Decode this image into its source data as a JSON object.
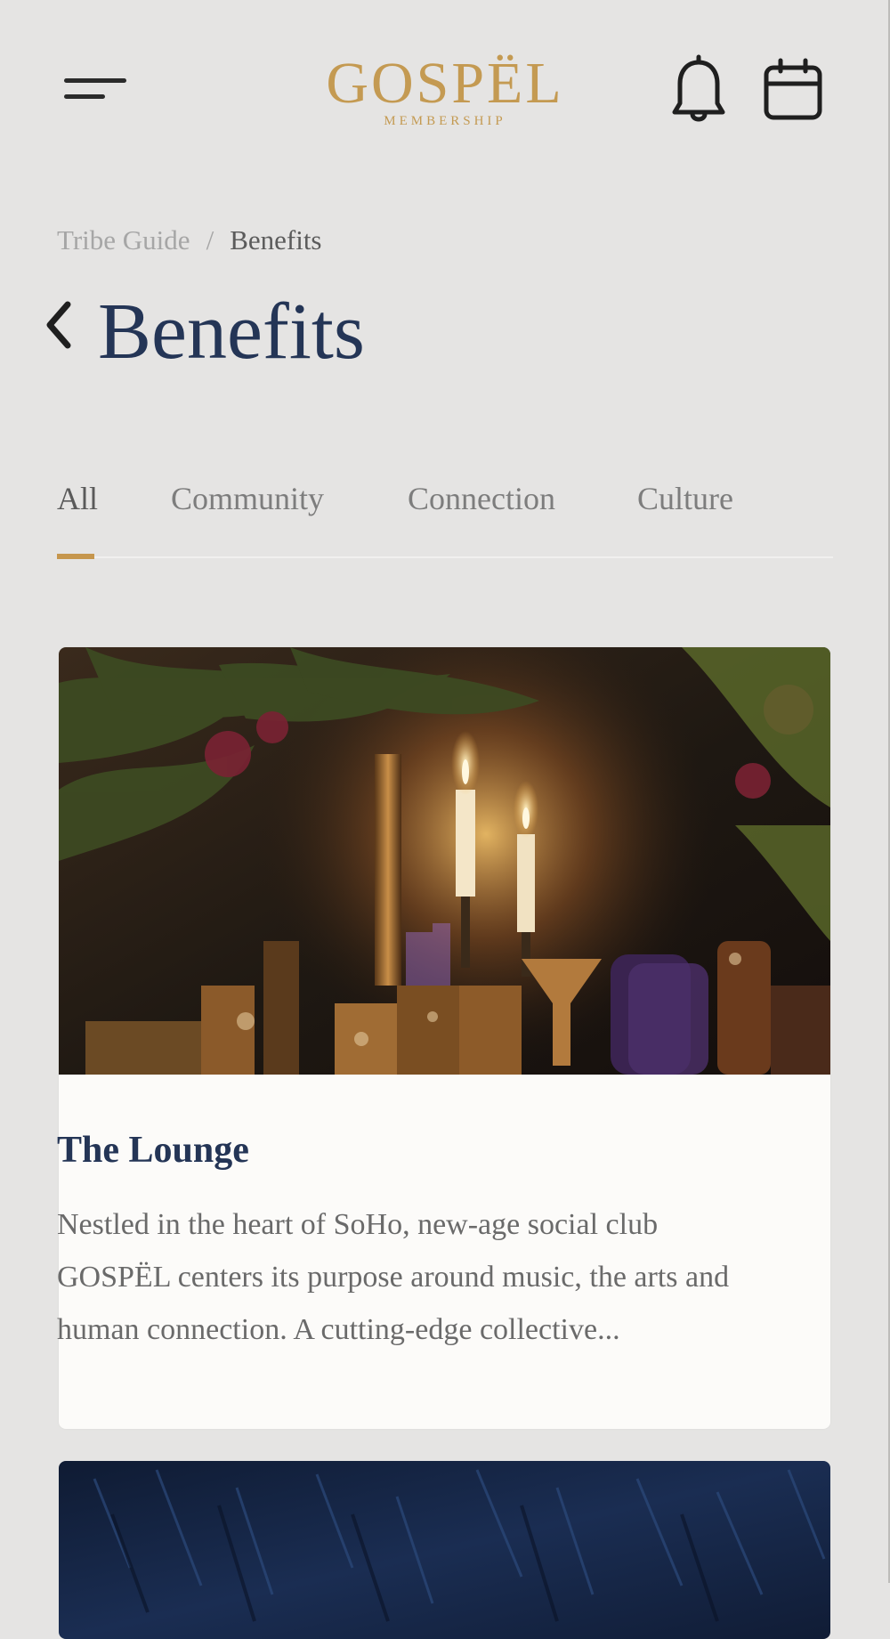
{
  "header": {
    "logo_word": "GOSPËL",
    "logo_sub": "MEMBERSHIP",
    "menu_icon": "hamburger-menu-icon",
    "notifications_icon": "bell-icon",
    "calendar_icon": "calendar-icon"
  },
  "breadcrumb": {
    "parent": "Tribe Guide",
    "separator": "/",
    "current": "Benefits"
  },
  "page": {
    "back_icon": "chevron-left-icon",
    "title": "Benefits"
  },
  "tabs": {
    "items": [
      {
        "label": "All"
      },
      {
        "label": "Community"
      },
      {
        "label": "Connection"
      },
      {
        "label": "Culture"
      }
    ],
    "active": "All"
  },
  "cards": [
    {
      "title": "The Lounge",
      "description": "Nestled in the heart of SoHo, new-age social club GOSPËL centers its purpose around music, the arts and human connection. A cutting-edge collective..."
    }
  ],
  "colors": {
    "background": "#e5e4e3",
    "brand_gold": "#c49a52",
    "title_navy": "#243556",
    "tab_indicator": "#c6964d",
    "card_background": "#fcfbf9"
  }
}
